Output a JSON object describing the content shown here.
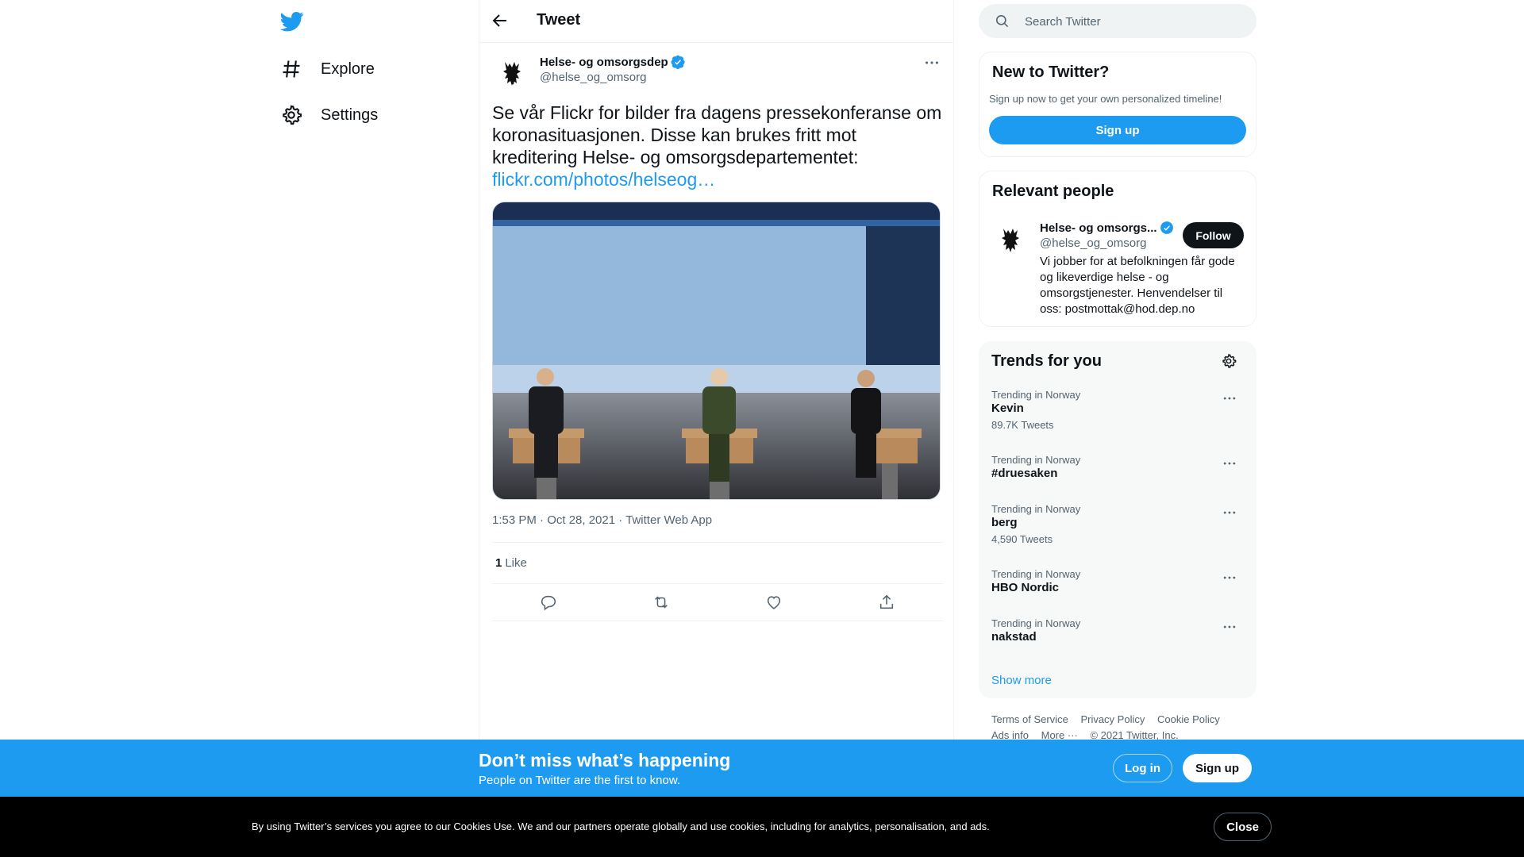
{
  "nav": {
    "logo_icon": "twitter-bird-icon",
    "items": [
      {
        "label": "Explore",
        "icon": "hashtag-icon"
      },
      {
        "label": "Settings",
        "icon": "gear-icon"
      }
    ]
  },
  "header": {
    "title": "Tweet"
  },
  "tweet": {
    "author_name": "Helse- og omsorgsdep",
    "author_handle": "@helse_og_omsorg",
    "verified": true,
    "text": "Se vår Flickr for bilder fra dagens pressekonferanse om koronasituasjonen. Disse kan brukes fritt mot kreditering Helse- og omsorgsdepartementet:",
    "link": "flickr.com/photos/helseog…",
    "timestamp": "1:53 PM · Oct 28, 2021 · Twitter Web App",
    "like_count": "1",
    "like_label": "Like"
  },
  "search": {
    "placeholder": "Search Twitter"
  },
  "new_to_twitter": {
    "title": "New to Twitter?",
    "subtitle": "Sign up now to get your own personalized timeline!",
    "button": "Sign up"
  },
  "relevant_people": {
    "title": "Relevant people",
    "name": "Helse- og omsorgs...",
    "handle": "@helse_og_omsorg",
    "follow": "Follow",
    "bio": "Vi jobber for at befolkningen får gode og likeverdige helse - og omsorgstjenester. Henvendelser til oss: postmottak@hod.dep.no"
  },
  "trends": {
    "title": "Trends for you",
    "items": [
      {
        "context": "Trending in Norway",
        "name": "Kevin",
        "count": "89.7K Tweets"
      },
      {
        "context": "Trending in Norway",
        "name": "#druesaken",
        "count": ""
      },
      {
        "context": "Trending in Norway",
        "name": "berg",
        "count": "4,590 Tweets"
      },
      {
        "context": "Trending in Norway",
        "name": "HBO Nordic",
        "count": ""
      },
      {
        "context": "Trending in Norway",
        "name": "nakstad",
        "count": ""
      }
    ],
    "show_more": "Show more"
  },
  "footer": {
    "links": [
      "Terms of Service",
      "Privacy Policy",
      "Cookie Policy",
      "Ads info",
      "More ···"
    ],
    "copyright": "© 2021 Twitter, Inc."
  },
  "banner": {
    "title": "Don’t miss what’s happening",
    "subtitle": "People on Twitter are the first to know.",
    "login": "Log in",
    "signup": "Sign up"
  },
  "cookie": {
    "text": "By using Twitter’s services you agree to our Cookies Use. We and our partners operate globally and use cookies, including for analytics, personalisation, and ads.",
    "close": "Close"
  },
  "colors": {
    "accent": "#1d9bf0",
    "text": "#0f1419",
    "secondary": "#536471"
  }
}
